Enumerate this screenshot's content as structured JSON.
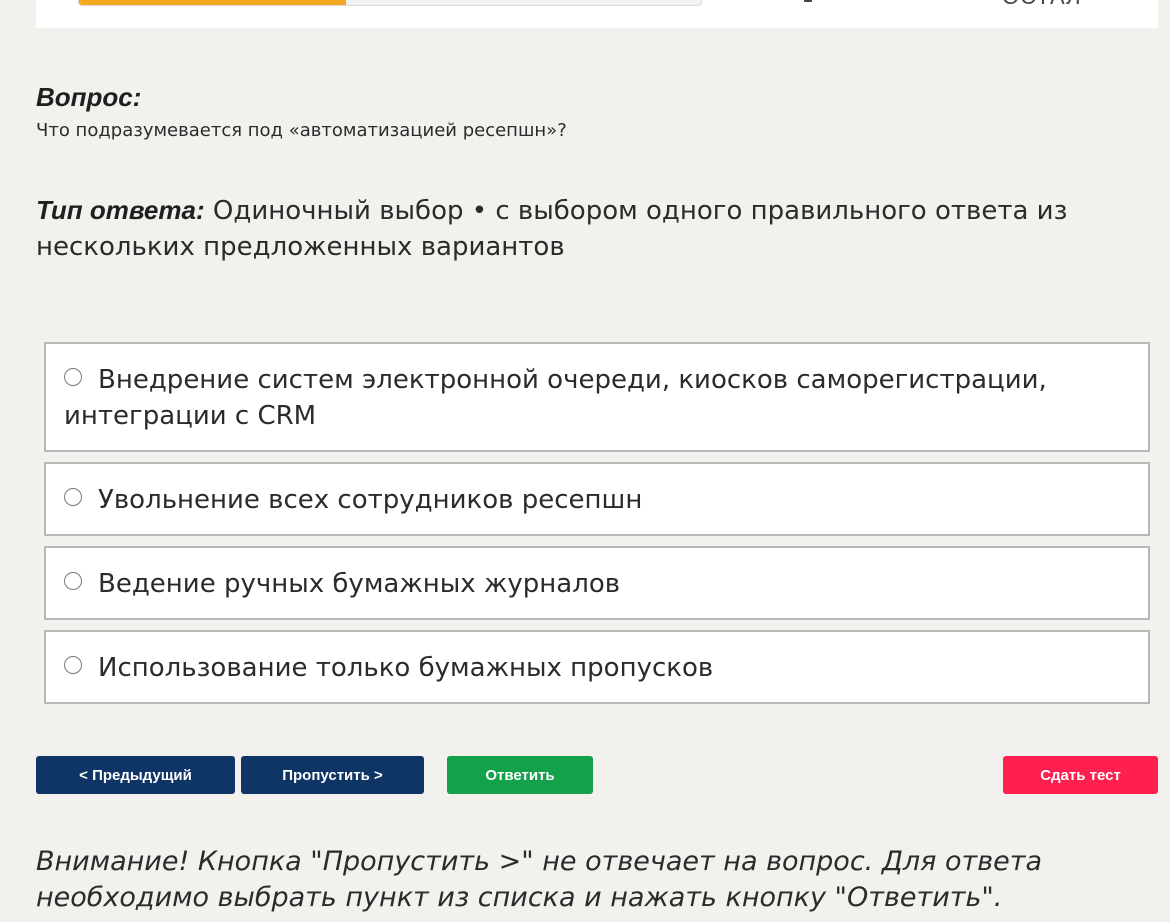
{
  "top": {
    "progress_fraction": 0.43,
    "right_text": "ОСТАЛ"
  },
  "question": {
    "label": "Вопрос:",
    "text": "Что подразумевается под «автоматизацией ресепшн»?"
  },
  "answer_type": {
    "label": "Тип ответа:",
    "text": " Одиночный выбор • с выбором одного правильного ответа из нескольких предложенных вариантов"
  },
  "options": [
    {
      "text": "Внедрение систем электронной очереди, киосков саморегистрации, интеграции с CRM"
    },
    {
      "text": "Увольнение всех сотрудников ресепшн"
    },
    {
      "text": "Ведение ручных бумажных журналов"
    },
    {
      "text": "Использование только бумажных пропусков"
    }
  ],
  "buttons": {
    "prev": "< Предыдущий",
    "skip": "Пропустить >",
    "answer": "Ответить",
    "submit": "Сдать тест"
  },
  "notice": "Внимание! Кнопка \"Пропустить >\" не отвечает на вопрос. Для ответа необходимо выбрать пункт из списка и нажать кнопку \"Ответить\".",
  "colors": {
    "background": "#f2f1ee",
    "progress": "#f6a821",
    "nav_button": "#0f3466",
    "answer_button": "#13a14a",
    "submit_button": "#ff2050"
  }
}
